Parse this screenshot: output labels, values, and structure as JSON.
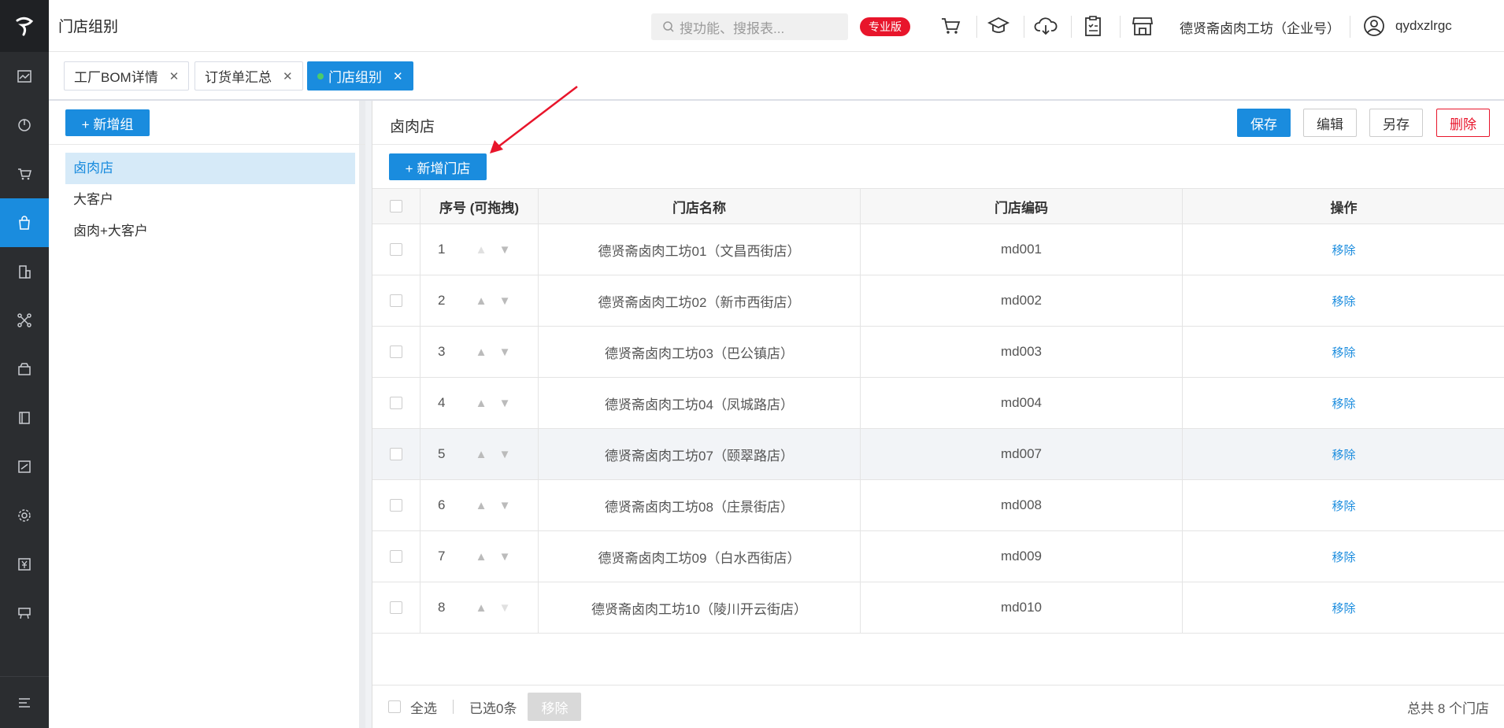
{
  "topbar": {
    "title": "门店组别",
    "search_placeholder": "搜功能、搜报表...",
    "badge": "专业版",
    "company": "德贤斋卤肉工坊（企业号）",
    "username": "qydxzlrgc"
  },
  "tabs": [
    {
      "label": "工厂BOM详情"
    },
    {
      "label": "订货单汇总"
    },
    {
      "label": "门店组别"
    }
  ],
  "groups": {
    "add_label": "+ 新增组",
    "items": [
      {
        "label": "卤肉店"
      },
      {
        "label": "大客户"
      },
      {
        "label": "卤肉+大客户"
      }
    ]
  },
  "main": {
    "title": "卤肉店",
    "save": "保存",
    "edit": "编辑",
    "save_as": "另存",
    "delete": "删除",
    "add_store": "+ 新增门店"
  },
  "table": {
    "headers": [
      "序号 (可拖拽)",
      "门店名称",
      "门店编码",
      "操作"
    ],
    "rows": [
      {
        "seq": "1",
        "name": "德贤斋卤肉工坊01（文昌西街店）",
        "code": "md001",
        "op": "移除"
      },
      {
        "seq": "2",
        "name": "德贤斋卤肉工坊02（新市西街店）",
        "code": "md002",
        "op": "移除"
      },
      {
        "seq": "3",
        "name": "德贤斋卤肉工坊03（巴公镇店）",
        "code": "md003",
        "op": "移除"
      },
      {
        "seq": "4",
        "name": "德贤斋卤肉工坊04（凤城路店）",
        "code": "md004",
        "op": "移除"
      },
      {
        "seq": "5",
        "name": "德贤斋卤肉工坊07（颐翠路店）",
        "code": "md007",
        "op": "移除"
      },
      {
        "seq": "6",
        "name": "德贤斋卤肉工坊08（庄景街店）",
        "code": "md008",
        "op": "移除"
      },
      {
        "seq": "7",
        "name": "德贤斋卤肉工坊09（白水西街店）",
        "code": "md009",
        "op": "移除"
      },
      {
        "seq": "8",
        "name": "德贤斋卤肉工坊10（陵川开云街店）",
        "code": "md010",
        "op": "移除"
      }
    ]
  },
  "footer": {
    "select_all": "全选",
    "selected": "已选0条",
    "remove": "移除",
    "total": "总共 8 个门店"
  },
  "colors": {
    "primary": "#1a8cde",
    "danger": "#e8152b",
    "rail": "#2b2d30"
  }
}
